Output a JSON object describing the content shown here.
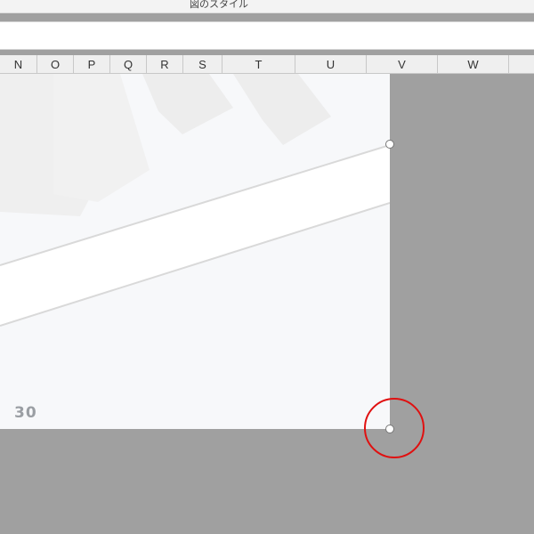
{
  "ribbon": {
    "label": "図のスタイル"
  },
  "columns": [
    "N",
    "O",
    "P",
    "Q",
    "R",
    "S",
    "T",
    "U",
    "V",
    "W"
  ],
  "picture": {
    "page_number": "30"
  },
  "colors": {
    "sheet_bg": "#a0a0a0",
    "picture_bg": "#f7f8fa",
    "highlight": "#e01010"
  }
}
